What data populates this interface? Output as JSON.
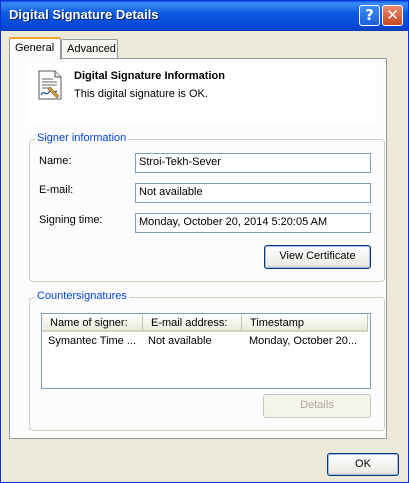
{
  "window": {
    "title": "Digital Signature Details"
  },
  "titlebar": {
    "help_label": "?",
    "close_label": "✕"
  },
  "tabs": [
    {
      "label": "General"
    },
    {
      "label": "Advanced"
    }
  ],
  "info": {
    "heading": "Digital Signature Information",
    "status": "This digital signature is OK."
  },
  "signer": {
    "group_label": "Signer information",
    "name_label": "Name:",
    "name_value": "Stroi-Tekh-Sever",
    "email_label": "E-mail:",
    "email_value": "Not available",
    "time_label": "Signing time:",
    "time_value": "Monday, October 20, 2014 5:20:05 AM",
    "view_certificate_label": "View Certificate"
  },
  "countersignatures": {
    "group_label": "Countersignatures",
    "columns": [
      "Name of signer:",
      "E-mail address:",
      "Timestamp"
    ],
    "rows": [
      {
        "name": "Symantec Time ...",
        "email": "Not available",
        "timestamp": "Monday, October 20..."
      }
    ],
    "details_label": "Details"
  },
  "footer": {
    "ok_label": "OK"
  }
}
